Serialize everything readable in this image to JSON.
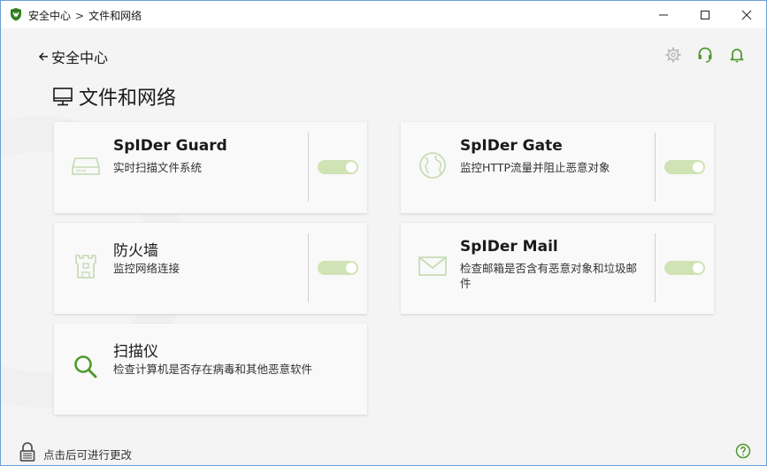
{
  "window": {
    "breadcrumb_root": "安全中心",
    "breadcrumb_sep": ">",
    "breadcrumb_current": "文件和网络"
  },
  "nav": {
    "back_label": "安全中心"
  },
  "page": {
    "title": "文件和网络"
  },
  "cards": [
    {
      "title": "SpIDer Guard",
      "desc": "实时扫描文件系统",
      "icon": "hard-drive-icon",
      "enabled": true
    },
    {
      "title": "SpIDer Gate",
      "desc": "监控HTTP流量并阻止恶意对象",
      "icon": "globe-icon",
      "enabled": true
    },
    {
      "title": "防火墙",
      "desc": "监控网络连接",
      "icon": "castle-tower-icon",
      "enabled": true
    },
    {
      "title": "SpIDer Mail",
      "desc": "检查邮箱是否含有恶意对象和垃圾邮件",
      "icon": "envelope-icon",
      "enabled": true
    },
    {
      "title": "扫描仪",
      "desc": "检查计算机是否存在病毒和其他恶意软件",
      "icon": "magnifier-icon"
    }
  ],
  "status": {
    "lock_text": "点击后可进行更改"
  },
  "colors": {
    "accent": "#4f9a2e",
    "toggle_disabled_on": "#cfe3b4",
    "icon_faded": "#c9dcb8"
  }
}
